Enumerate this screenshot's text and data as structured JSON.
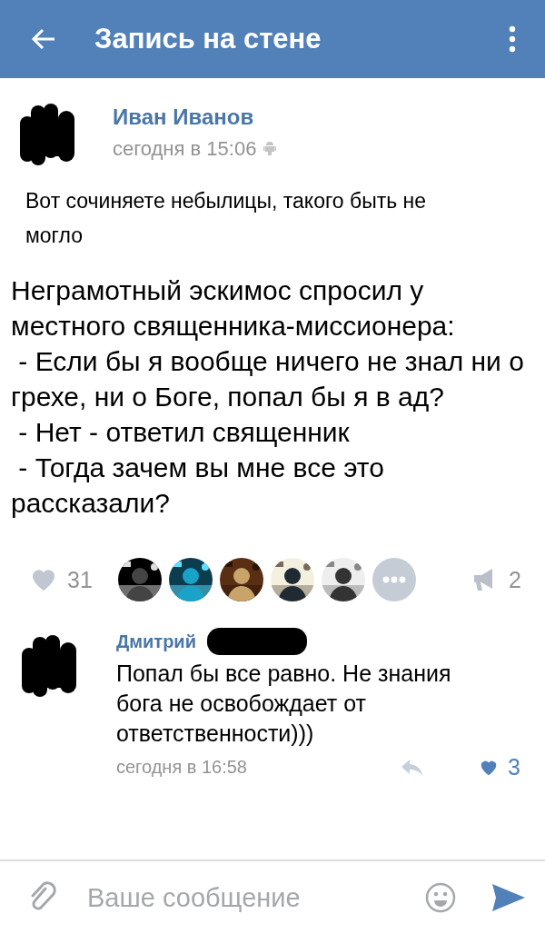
{
  "header": {
    "title": "Запись на стене"
  },
  "post": {
    "author": "Иван Иванов",
    "time": "сегодня в 15:06",
    "via_android": true,
    "text": "Вот сочиняете небылицы, такого быть не могло",
    "body": "Неграмотный эскимос спросил у местного священника-миссионера:\n - Если бы я вообще ничего не знал ни о грехе, ни о Боге, попал бы я в ад?\n - Нет - ответил священник\n - Тогда зачем вы мне все это рассказали?",
    "likes": {
      "count": "31",
      "liked": false
    },
    "likers": [
      {
        "kind": "picture"
      },
      {
        "kind": "picture"
      },
      {
        "kind": "picture"
      },
      {
        "kind": "picture"
      },
      {
        "kind": "picture"
      },
      {
        "kind": "more"
      }
    ],
    "reposts": "2"
  },
  "comment": {
    "author": "Дмитрий",
    "text": "Попал бы все равно. Не знания бога не освобождает от ответственности)))",
    "time": "сегодня в 16:58",
    "likes": {
      "count": "3",
      "liked": true
    }
  },
  "composer": {
    "placeholder": "Ваше сообщение"
  }
}
